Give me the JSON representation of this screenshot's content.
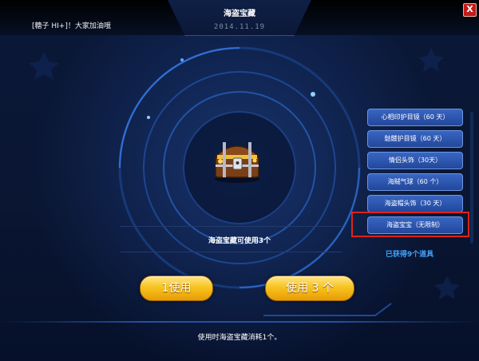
{
  "window": {
    "title": "海盗宝藏",
    "date": "2014.11.19",
    "close_label": "X"
  },
  "chat": {
    "message": "[糖子 HI+]！大家加油哦"
  },
  "main": {
    "item_icon": "treasure-chest-icon",
    "usable_text": "海盗宝藏可使用3个",
    "use_one_label": "1使用",
    "use_three_label": "使用 3 个",
    "note": "使用时海盗宝藏消耗1个。"
  },
  "sidebar": {
    "items": [
      {
        "label": "心相印护目镜（60 天）"
      },
      {
        "label": "骷髅护目镜（60 天）"
      },
      {
        "label": "情侣头饰（30天）"
      },
      {
        "label": "海贼气球（60 个）"
      },
      {
        "label": "海盗帽头饰（30 天）"
      },
      {
        "label": "海盗宝宝（无限制）"
      }
    ],
    "highlighted_index": 5,
    "obtained_text": "已获得9个道具"
  },
  "colors": {
    "accent_yellow": "#f7c41f",
    "item_blue": "#2f5bb5",
    "highlight_red": "#e0221a",
    "link_blue": "#3fa4ff"
  }
}
